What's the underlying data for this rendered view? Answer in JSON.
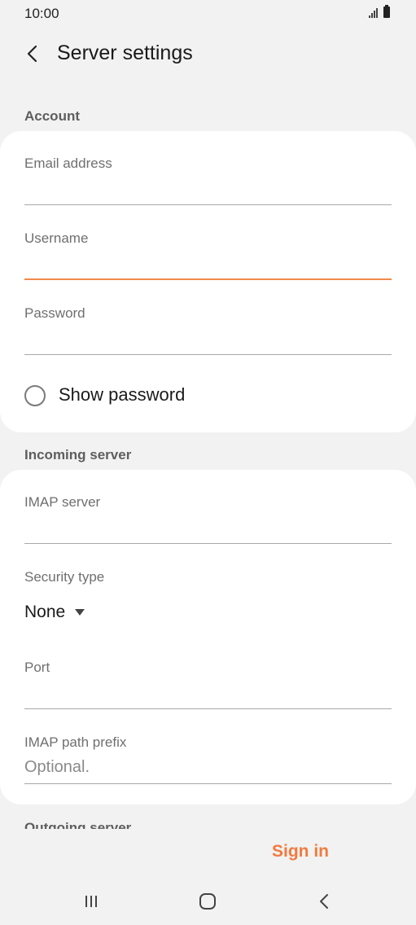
{
  "status_bar": {
    "time": "10:00"
  },
  "app_bar": {
    "title": "Server settings"
  },
  "account": {
    "header": "Account",
    "email_label": "Email address",
    "email_value": "",
    "username_label": "Username",
    "username_value": "",
    "password_label": "Password",
    "password_value": "",
    "show_password_label": "Show password"
  },
  "incoming": {
    "header": "Incoming server",
    "imap_server_label": "IMAP server",
    "imap_server_value": "",
    "security_type_label": "Security type",
    "security_type_value": "None",
    "port_label": "Port",
    "port_value": "",
    "path_prefix_label": "IMAP path prefix",
    "path_prefix_placeholder": "Optional."
  },
  "outgoing": {
    "header": "Outgoing server"
  },
  "actions": {
    "sign_in": "Sign in"
  },
  "colors": {
    "accent": "#f07b3f",
    "background": "#f2f2f2",
    "card": "#ffffff"
  },
  "icons": {
    "back": "chevron-left-icon",
    "dropdown": "triangle-down-icon",
    "nav_recents": "recents-icon",
    "nav_home": "home-icon",
    "nav_back": "back-icon"
  }
}
